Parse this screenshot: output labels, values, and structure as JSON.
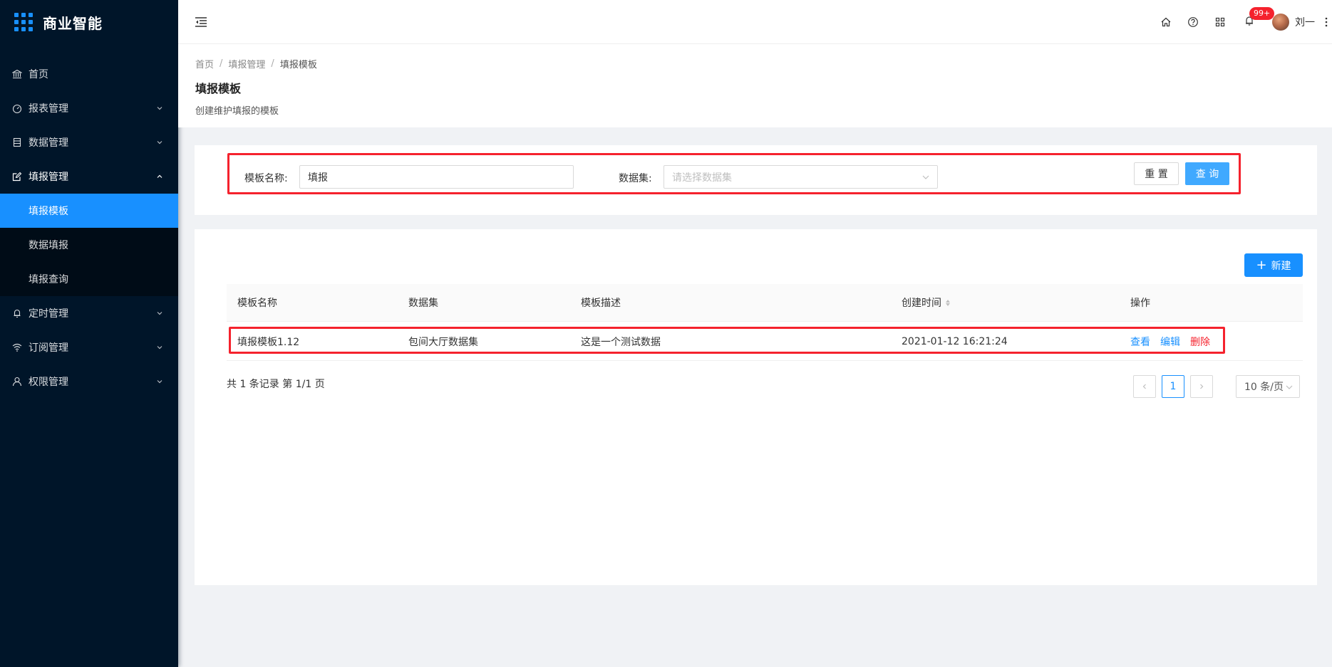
{
  "app": {
    "title": "商业智能"
  },
  "sidebar": {
    "items": [
      {
        "label": "首页",
        "icon": "bank-icon"
      },
      {
        "label": "报表管理",
        "icon": "dashboard-icon"
      },
      {
        "label": "数据管理",
        "icon": "database-icon"
      },
      {
        "label": "填报管理",
        "icon": "form-icon",
        "open": true,
        "children": [
          {
            "label": "填报模板",
            "active": true
          },
          {
            "label": "数据填报"
          },
          {
            "label": "填报查询"
          }
        ]
      },
      {
        "label": "定时管理",
        "icon": "bell-icon"
      },
      {
        "label": "订阅管理",
        "icon": "wifi-icon"
      },
      {
        "label": "权限管理",
        "icon": "user-icon"
      }
    ]
  },
  "header": {
    "notification_count": "99+",
    "username": "刘一"
  },
  "breadcrumb": [
    "首页",
    "填报管理",
    "填报模板"
  ],
  "page": {
    "title": "填报模板",
    "description": "创建维护填报的模板"
  },
  "search": {
    "name_label": "模板名称:",
    "name_value": "填报",
    "dataset_label": "数据集:",
    "dataset_placeholder": "请选择数据集",
    "reset_label": "重 置",
    "query_label": "查 询"
  },
  "table": {
    "new_label": "新建",
    "columns": [
      "模板名称",
      "数据集",
      "模板描述",
      "创建时间",
      "操作"
    ],
    "rows": [
      {
        "name": "填报模板1.12",
        "dataset": "包间大厅数据集",
        "description": "这是一个测试数据",
        "created": "2021-01-12 16:21:24",
        "actions": [
          "查看",
          "编辑",
          "删除"
        ]
      }
    ]
  },
  "pagination": {
    "summary": "共 1 条记录 第 1/1 页",
    "current_page": "1",
    "page_size": "10 条/页"
  },
  "colors": {
    "sidebar_bg": "#001529",
    "primary": "#1890ff",
    "danger": "#f5222d"
  }
}
